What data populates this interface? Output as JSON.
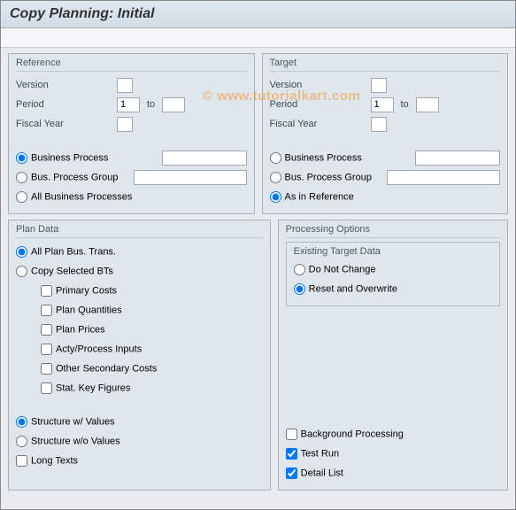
{
  "title": "Copy Planning: Initial",
  "watermark": "© www.tutorialkart.com",
  "reference": {
    "title": "Reference",
    "version_label": "Version",
    "version_value": "",
    "period_label": "Period",
    "period_from": "1",
    "to_label": "to",
    "period_to": "",
    "fiscal_label": "Fiscal Year",
    "fiscal_value": "",
    "opt_bp": "Business Process",
    "opt_bpg": "Bus. Process Group",
    "opt_all": "All Business Processes",
    "bp_value": "",
    "bpg_value": ""
  },
  "target": {
    "title": "Target",
    "version_label": "Version",
    "version_value": "",
    "period_label": "Period",
    "period_from": "1",
    "to_label": "to",
    "period_to": "",
    "fiscal_label": "Fiscal Year",
    "fiscal_value": "",
    "opt_bp": "Business Process",
    "opt_bpg": "Bus. Process Group",
    "opt_asref": "As in Reference",
    "bp_value": "",
    "bpg_value": ""
  },
  "plan": {
    "title": "Plan Data",
    "opt_all": "All Plan Bus. Trans.",
    "opt_sel": "Copy Selected BTs",
    "cb_primary": "Primary Costs",
    "cb_qty": "Plan Quantities",
    "cb_prices": "Plan Prices",
    "cb_acty": "Acty/Process Inputs",
    "cb_othsec": "Other Secondary Costs",
    "cb_skf": "Stat. Key Figures",
    "opt_sv": "Structure w/ Values",
    "opt_snv": "Structure w/o Values",
    "cb_long": "Long Texts"
  },
  "proc": {
    "title": "Processing Options",
    "etd_title": "Existing Target Data",
    "opt_dnc": "Do Not Change",
    "opt_rao": "Reset and Overwrite",
    "cb_bg": "Background Processing",
    "cb_test": "Test Run",
    "cb_detail": "Detail List"
  }
}
